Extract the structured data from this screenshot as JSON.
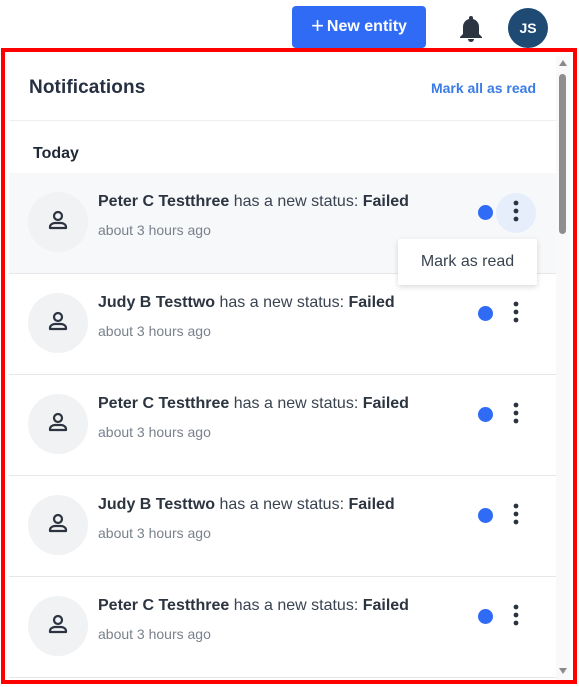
{
  "topbar": {
    "new_entity_plus": "+",
    "new_entity_label": "New entity",
    "bell_icon": "bell-icon",
    "user_initials": "JS"
  },
  "colors": {
    "primary": "#2f6bf5",
    "avatar_bg": "#1e4a73",
    "link": "#3b7be6",
    "unread_dot": "#2f6bf5"
  },
  "panel": {
    "title": "Notifications",
    "mark_all_label": "Mark all as read",
    "section_label": "Today",
    "dropdown": {
      "mark_as_read_label": "Mark as read"
    },
    "notifications": [
      {
        "name": "Peter C Testthree",
        "middle": " has a new status: ",
        "status": "Failed",
        "time": "about 3 hours ago",
        "unread": true
      },
      {
        "name": "Judy B Testtwo",
        "middle": " has a new status: ",
        "status": "Failed",
        "time": "about 3 hours ago",
        "unread": true
      },
      {
        "name": "Peter C Testthree",
        "middle": " has a new status: ",
        "status": "Failed",
        "time": "about 3 hours ago",
        "unread": true
      },
      {
        "name": "Judy B Testtwo",
        "middle": " has a new status: ",
        "status": "Failed",
        "time": "about 3 hours ago",
        "unread": true
      },
      {
        "name": "Peter C Testthree",
        "middle": " has a new status: ",
        "status": "Failed",
        "time": "about 3 hours ago",
        "unread": true
      }
    ]
  }
}
